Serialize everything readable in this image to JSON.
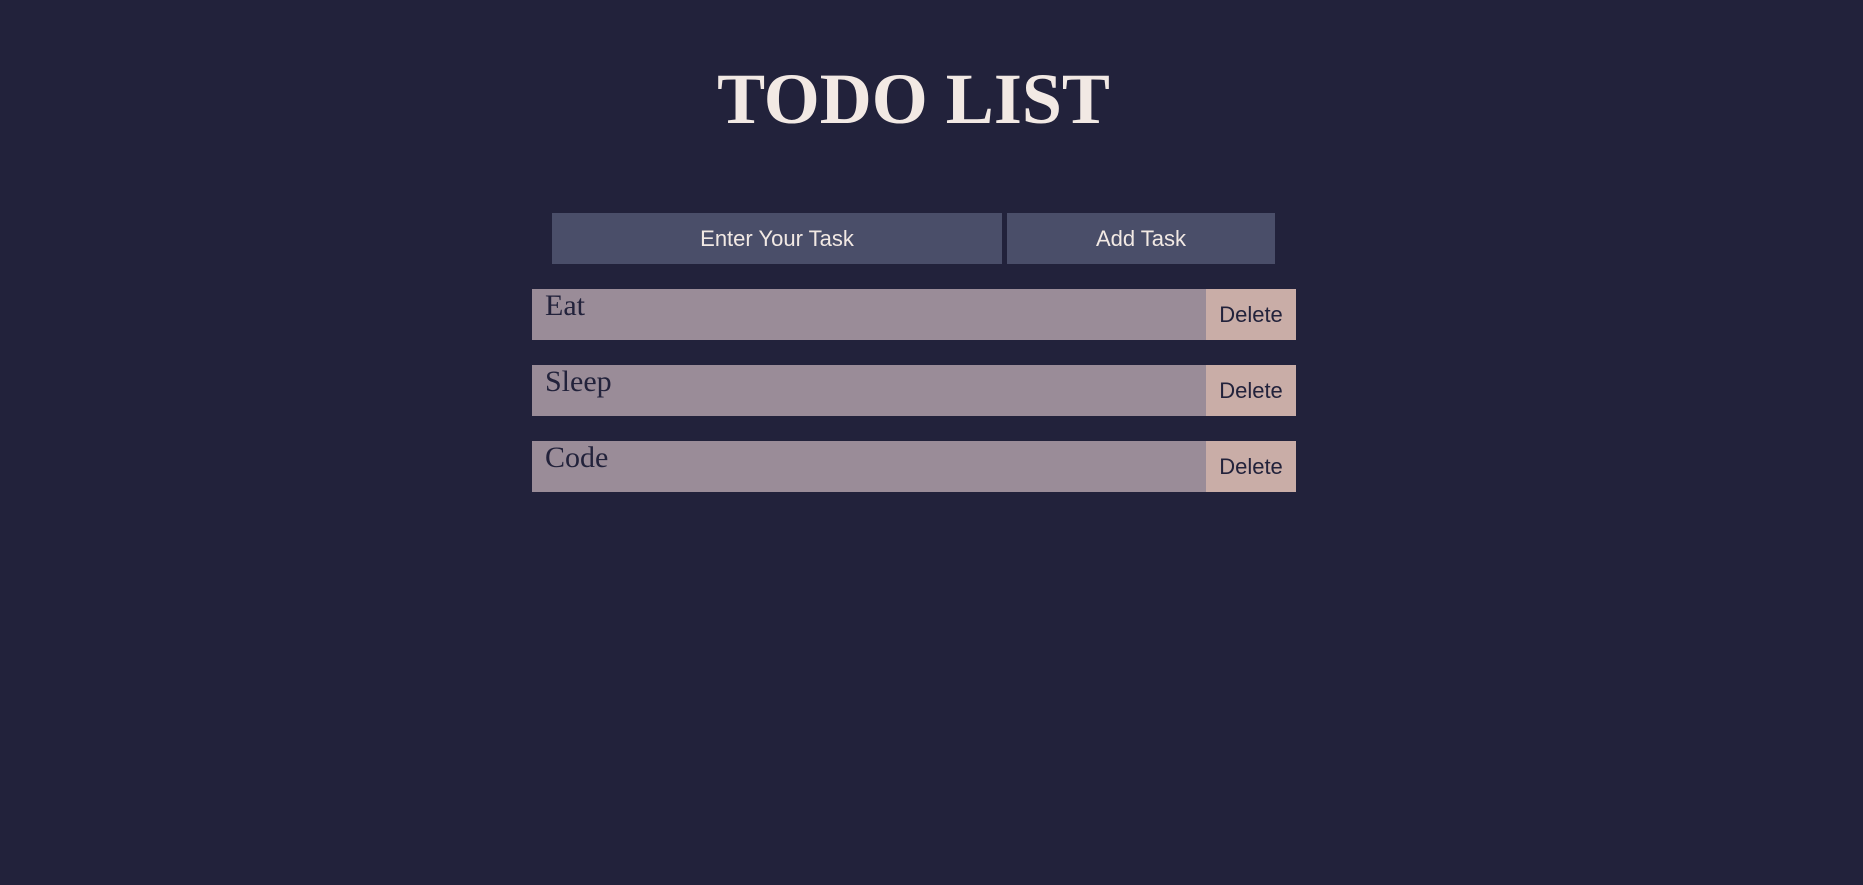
{
  "colors": {
    "background": "#22223b",
    "title": "#f2e9e4",
    "input_bg": "#4a4e69",
    "task_bg": "#9a8c98",
    "delete_bg": "#c9ada7"
  },
  "header": {
    "title": "TODO LIST"
  },
  "form": {
    "input_placeholder": "Enter Your Task",
    "input_value": "",
    "add_button_label": "Add Task"
  },
  "tasks": [
    {
      "text": "Eat",
      "delete_label": "Delete"
    },
    {
      "text": "Sleep",
      "delete_label": "Delete"
    },
    {
      "text": "Code",
      "delete_label": "Delete"
    }
  ]
}
